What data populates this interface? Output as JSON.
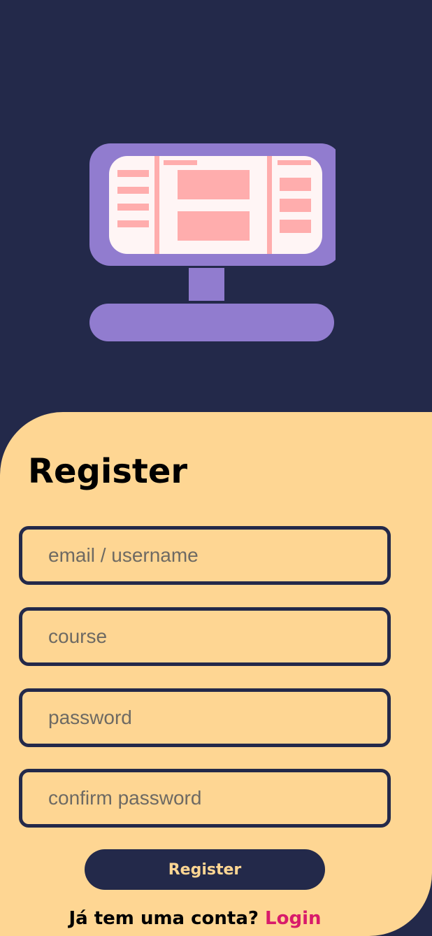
{
  "colors": {
    "background": "#23294a",
    "panel": "#fed693",
    "monitor": "#917ccf",
    "screen": "#fff5f5",
    "screen_blocks": "#ffadad",
    "link": "#d81b6a"
  },
  "illustration": {
    "icon": "computer-monitor-illustration"
  },
  "form": {
    "title": "Register",
    "fields": [
      {
        "placeholder": "email / username",
        "value": ""
      },
      {
        "placeholder": "course",
        "value": ""
      },
      {
        "placeholder": "password",
        "value": ""
      },
      {
        "placeholder": "confirm password",
        "value": ""
      }
    ],
    "submit_label": "Register"
  },
  "footer": {
    "prompt": "Já tem uma conta?",
    "link_label": "Login"
  }
}
